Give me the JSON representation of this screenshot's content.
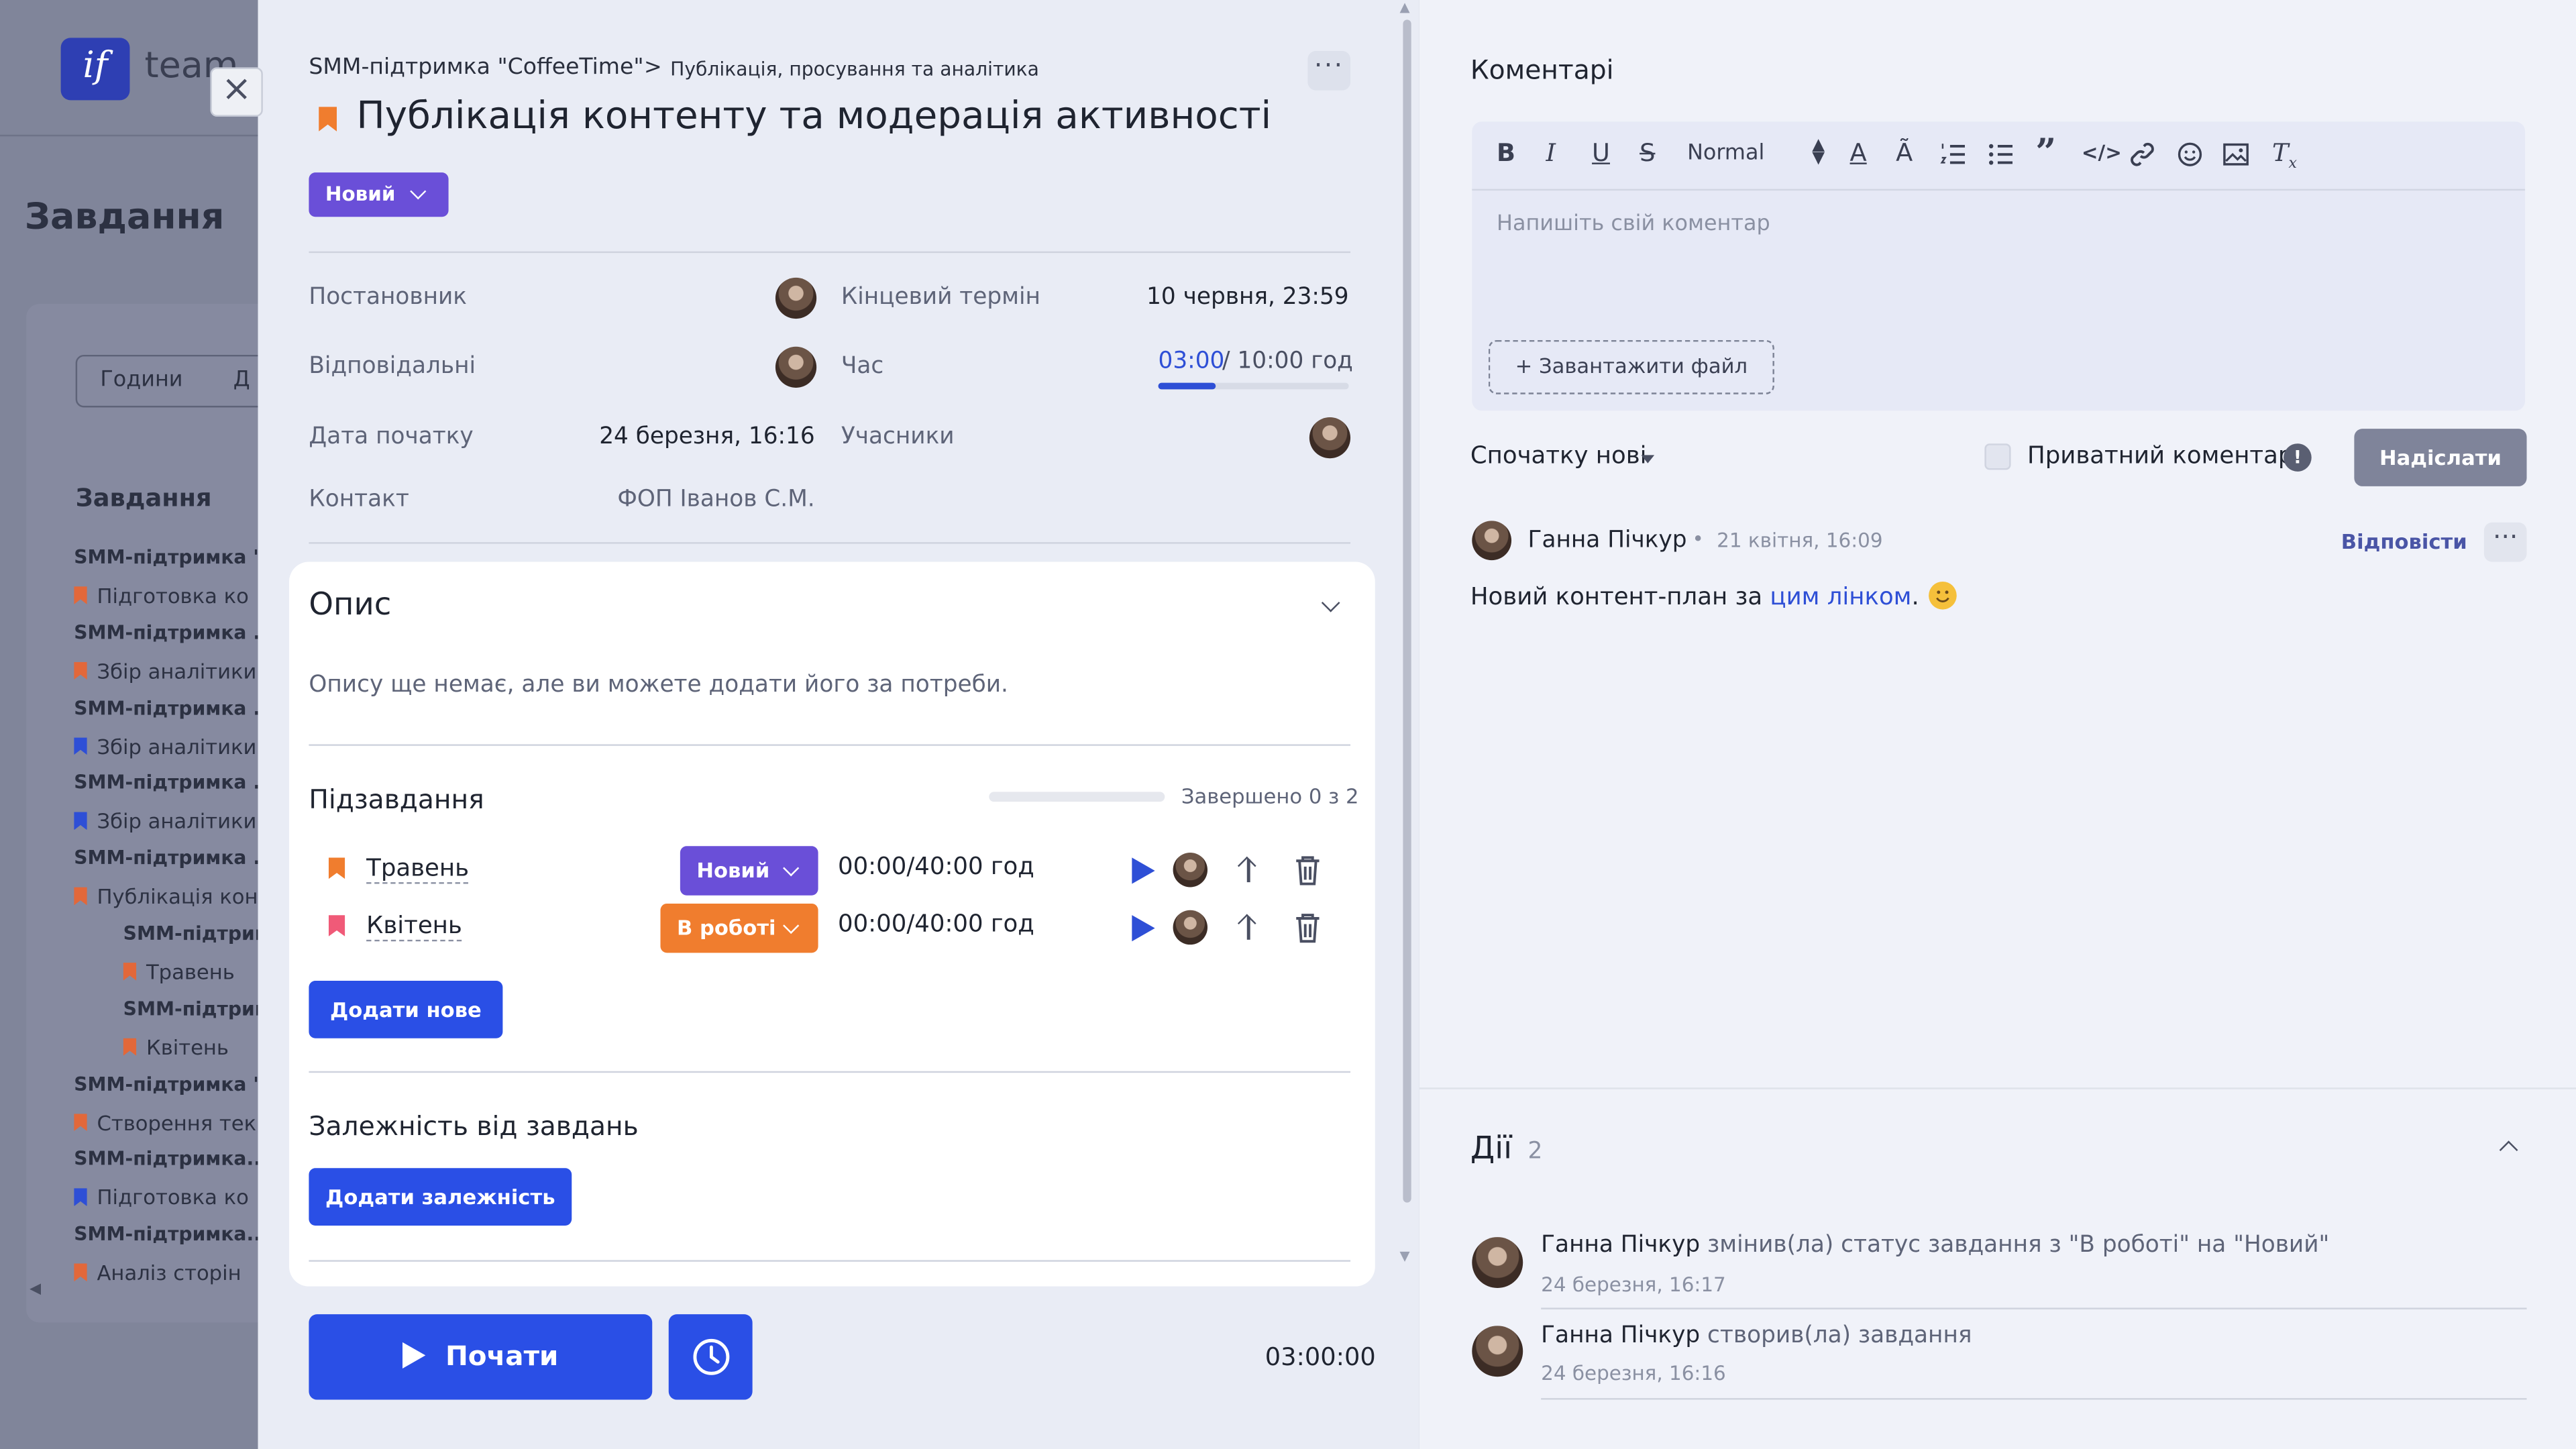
{
  "background_app": {
    "logo_letters": "if",
    "logo_text": "team",
    "page_title": "Завдання",
    "toggle": {
      "hours": "Години",
      "days": "Д"
    },
    "tasks_heading": "Завдання",
    "rows": [
      {
        "text": "SMM-підтримка \"...",
        "bold": true,
        "flag": ""
      },
      {
        "text": "Підготовка ко",
        "bold": false,
        "flag": "#e2683a"
      },
      {
        "text": "SMM-підтримка ...",
        "bold": true,
        "flag": ""
      },
      {
        "text": "Збір аналітики",
        "bold": false,
        "flag": "#e2683a"
      },
      {
        "text": "SMM-підтримка ...",
        "bold": true,
        "flag": ""
      },
      {
        "text": "Збір аналітики",
        "bold": false,
        "flag": "#2e4fd6"
      },
      {
        "text": "SMM-підтримка ...",
        "bold": true,
        "flag": ""
      },
      {
        "text": "Збір аналітики",
        "bold": false,
        "flag": "#2e4fd6"
      },
      {
        "text": "SMM-підтримка ...",
        "bold": true,
        "flag": ""
      },
      {
        "text": "Публікація кон",
        "bold": false,
        "flag": "#e2683a"
      },
      {
        "text": "SMM-підтрим",
        "bold": true,
        "flag": ""
      },
      {
        "text": "Травень",
        "bold": false,
        "flag": "#e2683a"
      },
      {
        "text": "SMM-підтрим",
        "bold": true,
        "flag": ""
      },
      {
        "text": "Квітень",
        "bold": false,
        "flag": "#e2683a"
      },
      {
        "text": "SMM-підтримка \"...",
        "bold": true,
        "flag": ""
      },
      {
        "text": "Створення тек",
        "bold": false,
        "flag": "#e2683a"
      },
      {
        "text": "SMM-підтримка...",
        "bold": true,
        "flag": ""
      },
      {
        "text": "Підготовка ко",
        "bold": false,
        "flag": "#2e4fd6"
      },
      {
        "text": "SMM-підтримка...",
        "bold": true,
        "flag": ""
      },
      {
        "text": "Аналіз сторін",
        "bold": false,
        "flag": "#e2683a"
      }
    ]
  },
  "task": {
    "breadcrumb_project": "SMM-підтримка \"CoffeeTime\"",
    "breadcrumb_sep": ">",
    "breadcrumb_section": "Публікація, просування та аналітика",
    "more_label": "···",
    "title": "Публікація контенту та модерація активності",
    "status": "Новий",
    "fields": {
      "creator_label": "Постановник",
      "deadline_label": "Кінцевий термін",
      "deadline_value": "10 червня, 23:59",
      "assignee_label": "Відповідальні",
      "time_label": "Час",
      "time_used": "03:00",
      "time_total": "/ 10:00 год",
      "time_progress": 0.3,
      "start_label": "Дата початку",
      "start_value": "24 березня, 16:16",
      "participants_label": "Учасники",
      "contact_label": "Контакт",
      "contact_value": "ФОП Іванов С.М."
    },
    "description": {
      "title": "Опис",
      "empty_text": "Опису ще немає, але ви можете додати його за потреби."
    },
    "subtasks": {
      "title": "Підзавдання",
      "done_text": "Завершено 0 з 2",
      "progress": 0,
      "items": [
        {
          "name": "Травень",
          "status": "Новий",
          "status_color": "#6a4fd8",
          "flag_color": "#f07d2e",
          "time": "00:00/40:00 год"
        },
        {
          "name": "Квітень",
          "status": "В роботі",
          "status_color": "#f07d2e",
          "flag_color": "#f05a78",
          "time": "00:00/40:00 год"
        }
      ],
      "add_label": "Додати нове"
    },
    "dependencies": {
      "title": "Залежність від завдань",
      "add_label": "Додати залежність"
    },
    "start_label": "Почати",
    "timer": "03:00:00"
  },
  "comments": {
    "title": "Коментарі",
    "toolbar": {
      "bold": "B",
      "italic": "I",
      "underline": "U",
      "strike": "S",
      "format": "Normal"
    },
    "placeholder": "Напишіть свій коментар",
    "upload_label": "+ Завантажити файл",
    "sort_label": "Спочатку нові",
    "private_label": "Приватний коментар",
    "info_label": "!",
    "send_label": "Надіслати",
    "items": [
      {
        "author": "Ганна Пічкур",
        "dot": "•",
        "date": "21 квітня, 16:09",
        "reply_label": "Відповісти",
        "text_before": "Новий контент-план за ",
        "link_text": "цим лінком",
        "text_after": "."
      }
    ]
  },
  "actions": {
    "title": "Дії",
    "count": "2",
    "items": [
      {
        "author": "Ганна Пічкур",
        "text": " змінив(ла) статус завдання з \"В роботі\" на \"Новий\"",
        "date": "24 березня, 16:17"
      },
      {
        "author": "Ганна Пічкур",
        "text": " створив(ла) завдання",
        "date": "24 березня, 16:16"
      }
    ]
  },
  "colors": {
    "accent": "#2a4fe6",
    "status_new": "#6a4fd8",
    "status_in_progress": "#f07d2e",
    "link": "#2e4fd6"
  }
}
